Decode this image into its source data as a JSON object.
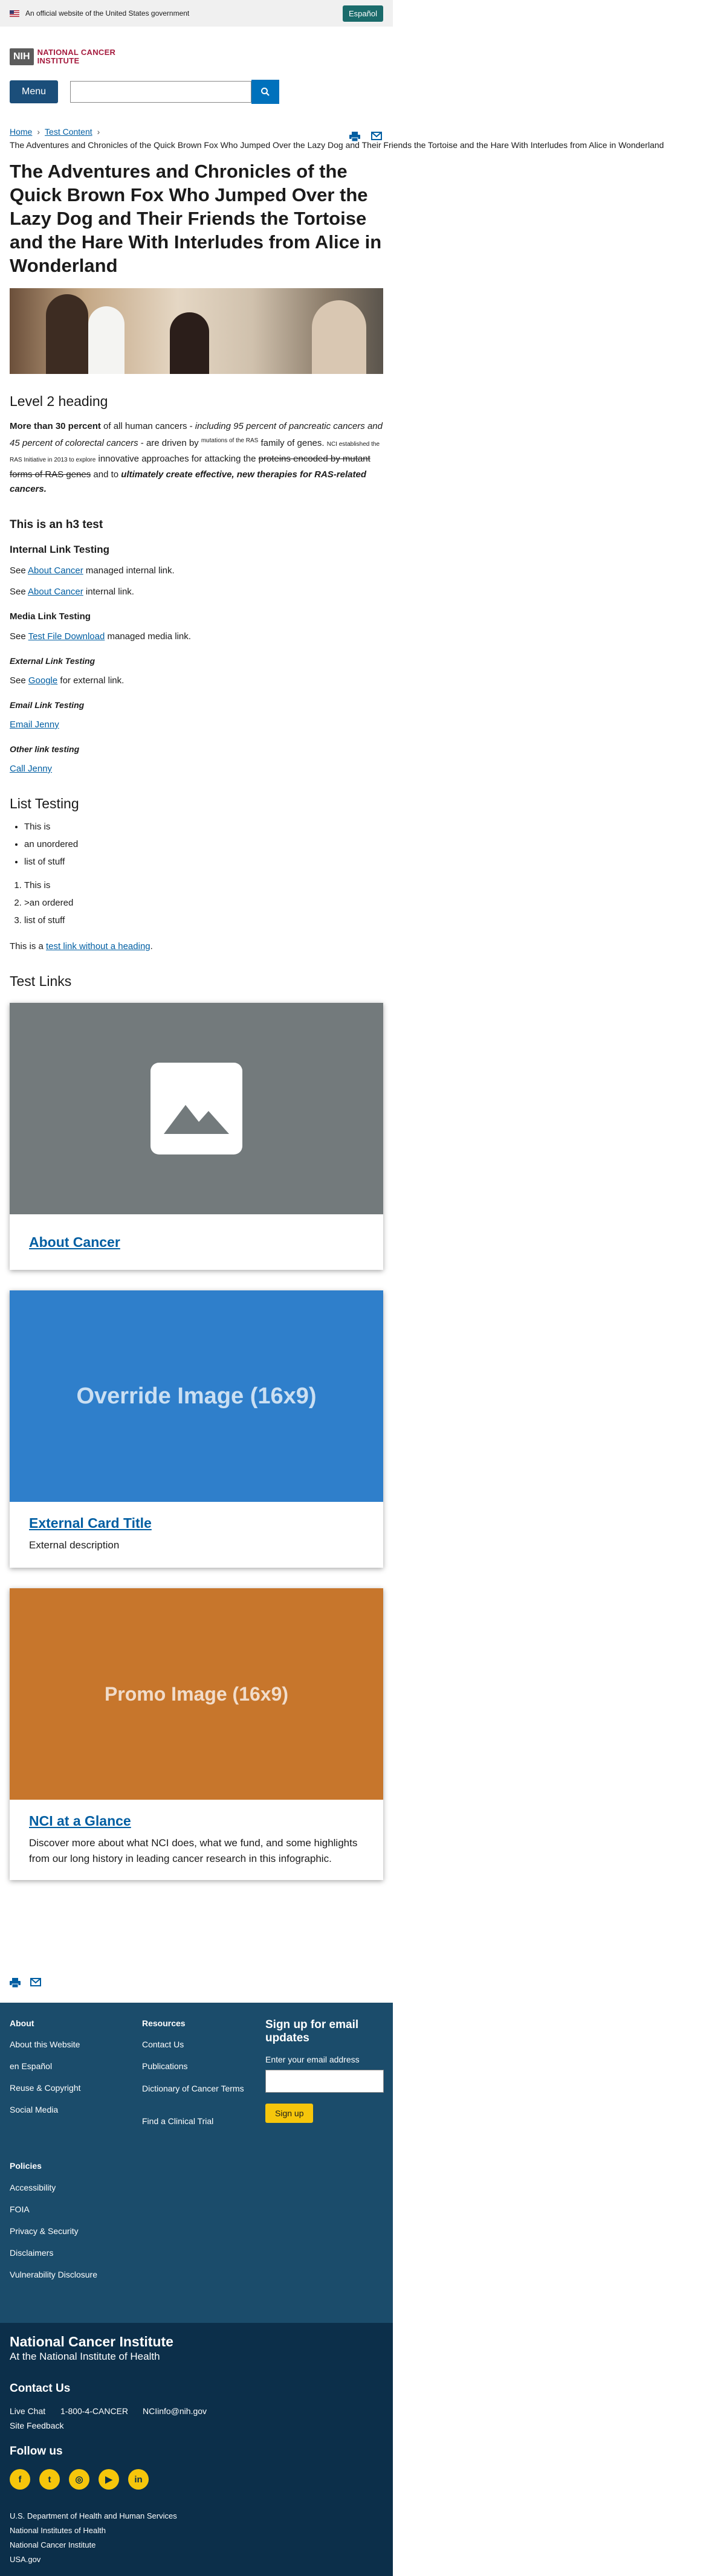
{
  "gov_banner": {
    "text": "An official website of the United States government",
    "language_button": "Español"
  },
  "logo": {
    "nih": "NIH",
    "line1": "NATIONAL CANCER",
    "line2": "INSTITUTE"
  },
  "nav": {
    "menu_label": "Menu",
    "search_placeholder": ""
  },
  "breadcrumb": {
    "items": [
      "Home",
      "Test Content"
    ],
    "current": "The Adventures and Chronicles of the Quick Brown Fox Who Jumped Over the Lazy Dog and Their Friends the Tortoise and the Hare With Interludes from Alice in Wonderland"
  },
  "page_title": "The Adventures and Chronicles of the Quick Brown Fox Who Jumped Over the Lazy Dog and Their Friends the Tortoise and the Hare With Interludes from Alice in Wonderland",
  "level2_heading": "Level 2 heading",
  "intro": {
    "bold_start": "More than 30 percent",
    "part1": " of all human cancers - ",
    "italic_part": "including 95 percent of pancreatic cancers and 45 percent of colorectal cancers",
    "part2": " - are driven by ",
    "sup_text": "mutations of the RAS",
    "part3": " family of genes",
    "part4": ". ",
    "small_text": "NCI established the RAS Initiative in 2013 to explore",
    "part5": " innovative approaches for attacking the ",
    "strike_text": "proteins encoded by mutant forms of RAS genes",
    "part6": " and to ",
    "bold_italic_end": "ultimately create effective, new therapies for RAS-related cancers."
  },
  "h3_test": "This is an h3 test",
  "internal": {
    "heading": "Internal Link Testing",
    "line1_pre": "See ",
    "line1_link": "About Cancer",
    "line1_post": " managed internal link.",
    "line2_pre": "See ",
    "line2_link": "About Cancer",
    "line2_post": " internal link."
  },
  "media": {
    "heading": "Media Link Testing",
    "pre": "See ",
    "link": "Test File Download",
    "post": " managed media link."
  },
  "external": {
    "heading": "External Link Testing",
    "pre": "See ",
    "link": "Google",
    "post": " for external link."
  },
  "email": {
    "heading": "Email Link Testing",
    "link": "Email Jenny"
  },
  "other": {
    "heading": "Other link testing",
    "link": "Call Jenny"
  },
  "lists": {
    "heading": "List Testing",
    "unordered": [
      "This is",
      "an unordered",
      "list of stuff"
    ],
    "ordered": [
      "This is",
      ">an ordered",
      "list of stuff"
    ],
    "footer_pre": "This is a ",
    "footer_link": "test link without a heading",
    "footer_post": "."
  },
  "test_links_heading": "Test Links",
  "cards": [
    {
      "image_label": "",
      "title": "About Cancer",
      "description": ""
    },
    {
      "image_label": "Override Image (16x9)",
      "title": "External Card Title",
      "description": "External description"
    },
    {
      "image_label": "Promo Image (16x9)",
      "title": "NCI at a Glance",
      "description": "Discover more about what NCI does, what we fund, and some highlights from our long history in leading cancer research in this infographic."
    }
  ],
  "colors": {
    "card2_bg": "#2f7fcb",
    "card3_bg": "#c7762c",
    "card1_bg": "#737a7c",
    "footer_bg": "#1b4c6b",
    "footer2_bg": "#0c2f4a",
    "accent": "#005ea2"
  },
  "footer": {
    "about": {
      "heading": "About",
      "links": [
        "About this Website",
        "en Español",
        "Reuse & Copyright",
        "Social Media"
      ]
    },
    "resources": {
      "heading": "Resources",
      "links": [
        "Contact Us",
        "Publications",
        "Dictionary of Cancer Terms",
        "Find a Clinical Trial"
      ]
    },
    "signup": {
      "heading": "Sign up for email updates",
      "label": "Enter your email address",
      "button": "Sign up"
    },
    "policies": {
      "heading": "Policies",
      "links": [
        "Accessibility",
        "FOIA",
        "Privacy & Security",
        "Disclaimers",
        "Vulnerability Disclosure"
      ]
    }
  },
  "footer_bottom": {
    "org": "National Cancer Institute",
    "sub": "At the National Institute of Health",
    "contact_heading": "Contact Us",
    "live_chat": "Live Chat",
    "phone": "1-800-4-CANCER",
    "email": "NCIinfo@nih.gov",
    "feedback": "Site Feedback",
    "follow_heading": "Follow us",
    "social": [
      "facebook-icon",
      "twitter-icon",
      "instagram-icon",
      "youtube-icon",
      "linkedin-icon"
    ],
    "agencies": [
      "U.S. Department of Health and Human Services",
      "National Institutes of Health",
      "National Cancer Institute",
      "USA.gov"
    ]
  }
}
